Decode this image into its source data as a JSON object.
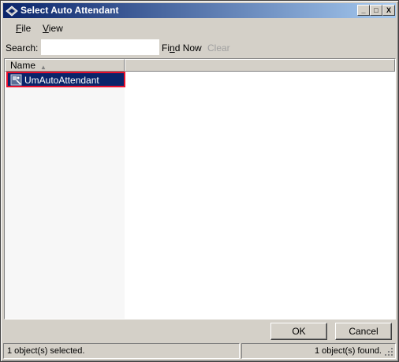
{
  "window": {
    "title": "Select Auto Attendant",
    "minimize_label": "_",
    "maximize_label": "□",
    "close_label": "X"
  },
  "menu": {
    "file": {
      "mnemonic": "F",
      "rest": "ile"
    },
    "view": {
      "mnemonic": "V",
      "rest": "iew"
    }
  },
  "toolbar": {
    "search_label": "Search:",
    "search_value": "",
    "find_now": {
      "before": "Fi",
      "mnemonic": "n",
      "after": "d Now"
    },
    "clear_label": "Clear"
  },
  "list": {
    "columns": [
      "Name",
      ""
    ],
    "sort_indicator": "▲",
    "rows": [
      {
        "name": "UmAutoAttendant",
        "icon": "auto-attendant-icon",
        "selected": true
      }
    ]
  },
  "buttons": {
    "ok": "OK",
    "cancel": "Cancel"
  },
  "status": {
    "selected": "1 object(s) selected.",
    "found": "1 object(s) found."
  },
  "colors": {
    "titlebar_start": "#0a246a",
    "titlebar_end": "#a6caf0",
    "selection": "#0a246a",
    "highlight_border": "#e8112d",
    "face": "#d4d0c8"
  }
}
